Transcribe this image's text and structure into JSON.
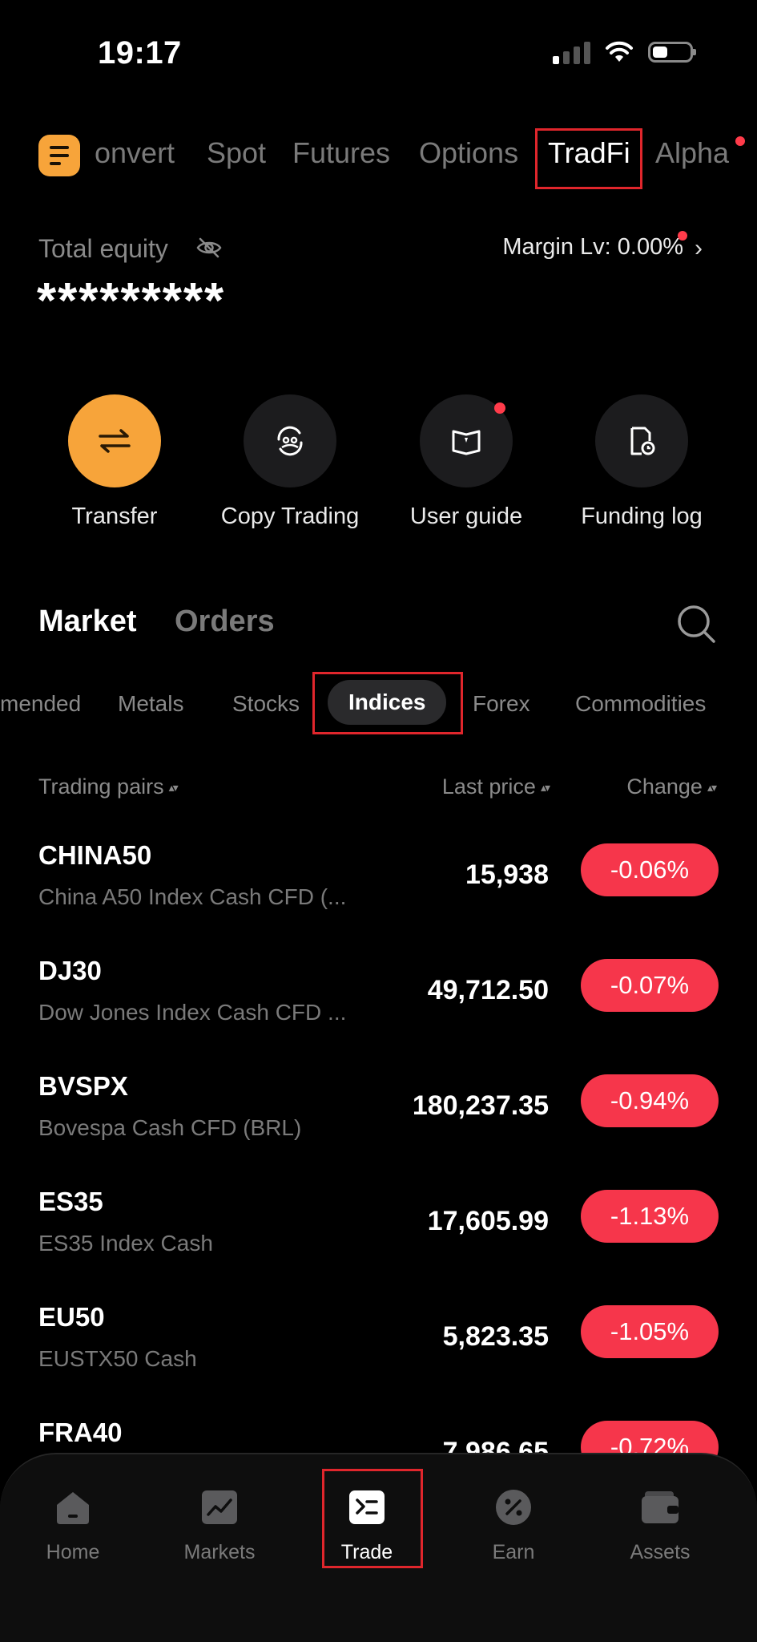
{
  "status": {
    "time": "19:17"
  },
  "top_tabs": [
    {
      "label": "onvert",
      "active": false
    },
    {
      "label": "Spot",
      "active": false
    },
    {
      "label": "Futures",
      "active": false
    },
    {
      "label": "Options",
      "active": false
    },
    {
      "label": "TradFi",
      "active": true
    },
    {
      "label": "Alpha",
      "active": false
    }
  ],
  "equity": {
    "label": "Total equity",
    "value": "*********",
    "margin_label": "Margin Lv: 0.00%"
  },
  "actions": [
    {
      "label": "Transfer",
      "icon": "swap-arrows-icon"
    },
    {
      "label": "Copy Trading",
      "icon": "copy-trading-icon"
    },
    {
      "label": "User guide",
      "icon": "book-icon"
    },
    {
      "label": "Funding log",
      "icon": "document-clock-icon"
    }
  ],
  "section_tabs": {
    "market": "Market",
    "orders": "Orders"
  },
  "categories": [
    {
      "label": "mended",
      "active": false
    },
    {
      "label": "Metals",
      "active": false
    },
    {
      "label": "Stocks",
      "active": false
    },
    {
      "label": "Indices",
      "active": true
    },
    {
      "label": "Forex",
      "active": false
    },
    {
      "label": "Commodities",
      "active": false
    }
  ],
  "table": {
    "headers": {
      "pairs": "Trading pairs",
      "price": "Last price",
      "change": "Change"
    },
    "rows": [
      {
        "symbol": "CHINA50",
        "name": "China A50 Index Cash CFD (...",
        "price": "15,938",
        "change": "-0.06%"
      },
      {
        "symbol": "DJ30",
        "name": "Dow Jones Index Cash CFD ...",
        "price": "49,712.50",
        "change": "-0.07%"
      },
      {
        "symbol": "BVSPX",
        "name": "Bovespa Cash CFD (BRL)",
        "price": "180,237.35",
        "change": "-0.94%"
      },
      {
        "symbol": "ES35",
        "name": "ES35 Index Cash",
        "price": "17,605.99",
        "change": "-1.13%"
      },
      {
        "symbol": "EU50",
        "name": "EUSTX50 Cash",
        "price": "5,823.35",
        "change": "-1.05%"
      },
      {
        "symbol": "FRA40",
        "name": "",
        "price": "7,986.65",
        "change": "-0.72%"
      }
    ]
  },
  "bottom_nav": [
    {
      "label": "Home",
      "active": false
    },
    {
      "label": "Markets",
      "active": false
    },
    {
      "label": "Trade",
      "active": true
    },
    {
      "label": "Earn",
      "active": false
    },
    {
      "label": "Assets",
      "active": false
    }
  ],
  "colors": {
    "accent": "#f7a43a",
    "negative": "#f6364b",
    "highlight_box": "#e0262c",
    "background": "#000000"
  }
}
